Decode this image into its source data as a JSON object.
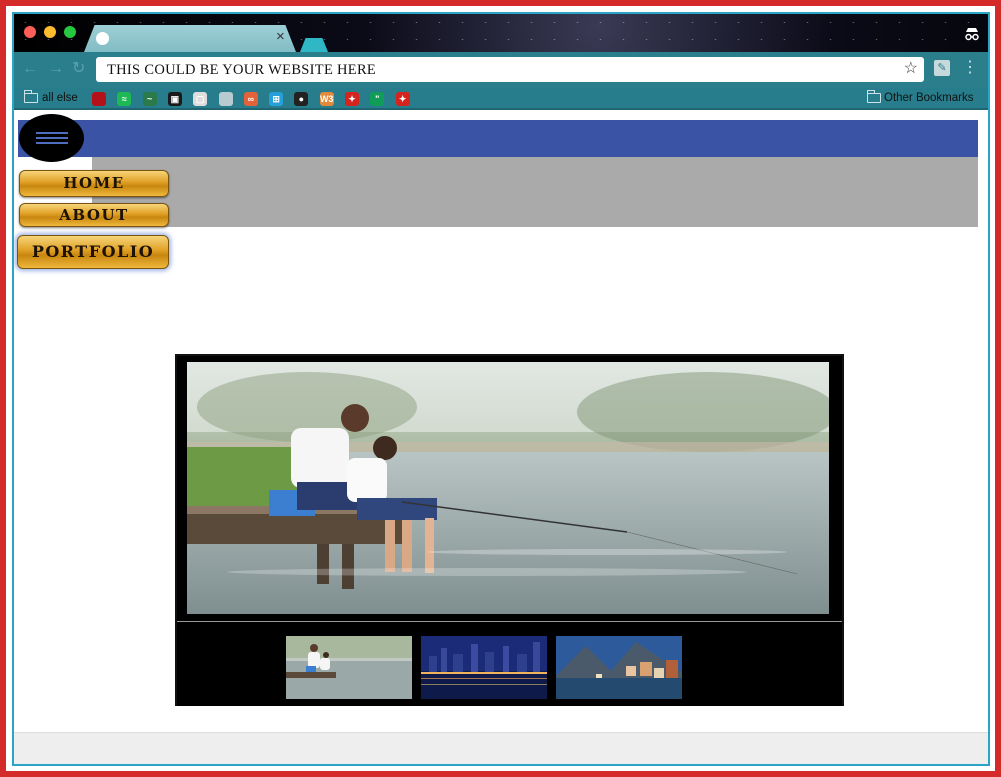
{
  "browser": {
    "tab_close": "×",
    "url": "THIS COULD BE YOUR WEBSITE HERE",
    "back": "←",
    "forward": "→",
    "reload": "↻",
    "star": "☆",
    "kebab": "⋮",
    "bookmarks": [
      {
        "label": "all else",
        "icon": "folder-icon"
      },
      {
        "label": "Other Bookmarks",
        "icon": "folder-icon"
      }
    ],
    "bookmark_icons": [
      {
        "icon": "pinterest-icon",
        "glyph": "",
        "color": "#b3121b"
      },
      {
        "icon": "spotify-icon",
        "glyph": "≈",
        "color": "#1db954"
      },
      {
        "icon": "chart-icon",
        "glyph": "~",
        "color": "#2a7a4a"
      },
      {
        "icon": "bus-icon",
        "glyph": "▣",
        "color": "#1a1a1a"
      },
      {
        "icon": "app-icon",
        "glyph": "▢",
        "color": "#dddddd"
      },
      {
        "icon": "doc-icon",
        "glyph": "",
        "color": "#b7cbd0"
      },
      {
        "icon": "chain-icon",
        "glyph": "∞",
        "color": "#e2623a"
      },
      {
        "icon": "windows-icon",
        "glyph": "⊞",
        "color": "#27a0da"
      },
      {
        "icon": "record-icon",
        "glyph": "●",
        "color": "#222222"
      },
      {
        "icon": "w3-icon",
        "glyph": "W3",
        "color": "#e28a3c"
      },
      {
        "icon": "maple-leaf-icon",
        "glyph": "✦",
        "color": "#d5231e"
      },
      {
        "icon": "hangouts-icon",
        "glyph": "\"",
        "color": "#0f9d58"
      },
      {
        "icon": "maple-leaf-box-icon",
        "glyph": "✦",
        "color": "#d5231e"
      }
    ]
  },
  "site": {
    "nav": [
      {
        "label": "HOME"
      },
      {
        "label": "ABOUT"
      },
      {
        "label": "PORTFOLIO"
      }
    ],
    "colors": {
      "header": "#3a53a4",
      "band": "#aaaaaa",
      "button_gold": "#e0a025"
    }
  },
  "slideshow": {
    "main_image": "father-and-son-fishing",
    "thumbnails": [
      {
        "image": "father-and-son-fishing"
      },
      {
        "image": "city-skyline-night"
      },
      {
        "image": "mountain-lake-village"
      }
    ]
  }
}
